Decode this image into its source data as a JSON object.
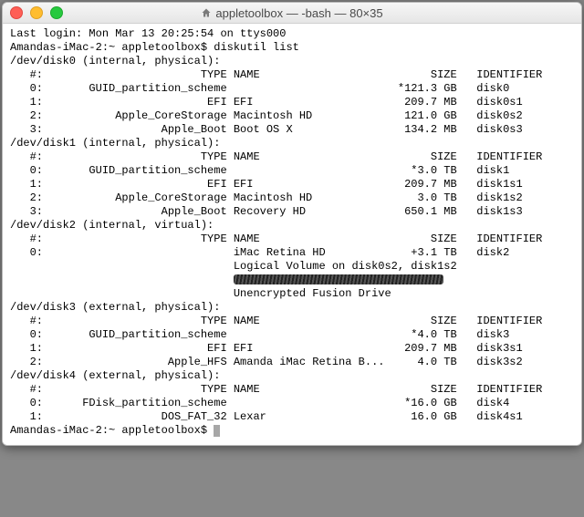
{
  "window": {
    "title": "appletoolbox — -bash — 80×35"
  },
  "login_line": "Last login: Mon Mar 13 20:25:54 on ttys000",
  "prompt1": "Amandas-iMac-2:~ appletoolbox$ ",
  "command1": "diskutil list",
  "prompt2": "Amandas-iMac-2:~ appletoolbox$ ",
  "header_cols": {
    "num": "#:",
    "type": "TYPE",
    "name": "NAME",
    "size": "SIZE",
    "id": "IDENTIFIER"
  },
  "disks": [
    {
      "header": "/dev/disk0 (internal, physical):",
      "rows": [
        {
          "num": "0:",
          "type": "GUID_partition_scheme",
          "name": "",
          "size": "*121.3 GB",
          "id": "disk0"
        },
        {
          "num": "1:",
          "type": "EFI",
          "name": "EFI",
          "size": "209.7 MB",
          "id": "disk0s1"
        },
        {
          "num": "2:",
          "type": "Apple_CoreStorage",
          "name": "Macintosh HD",
          "size": "121.0 GB",
          "id": "disk0s2"
        },
        {
          "num": "3:",
          "type": "Apple_Boot",
          "name": "Boot OS X",
          "size": "134.2 MB",
          "id": "disk0s3"
        }
      ]
    },
    {
      "header": "/dev/disk1 (internal, physical):",
      "rows": [
        {
          "num": "0:",
          "type": "GUID_partition_scheme",
          "name": "",
          "size": "*3.0 TB",
          "id": "disk1"
        },
        {
          "num": "1:",
          "type": "EFI",
          "name": "EFI",
          "size": "209.7 MB",
          "id": "disk1s1"
        },
        {
          "num": "2:",
          "type": "Apple_CoreStorage",
          "name": "Macintosh HD",
          "size": "3.0 TB",
          "id": "disk1s2"
        },
        {
          "num": "3:",
          "type": "Apple_Boot",
          "name": "Recovery HD",
          "size": "650.1 MB",
          "id": "disk1s3"
        }
      ]
    },
    {
      "header": "/dev/disk2 (internal, virtual):",
      "rows": [
        {
          "num": "0:",
          "type": "",
          "name": "iMac Retina HD",
          "size": "+3.1 TB",
          "id": "disk2"
        }
      ],
      "extra": [
        "Logical Volume on disk0s2, disk1s2",
        "__REDACTED__",
        "Unencrypted Fusion Drive"
      ]
    },
    {
      "header": "/dev/disk3 (external, physical):",
      "rows": [
        {
          "num": "0:",
          "type": "GUID_partition_scheme",
          "name": "",
          "size": "*4.0 TB",
          "id": "disk3"
        },
        {
          "num": "1:",
          "type": "EFI",
          "name": "EFI",
          "size": "209.7 MB",
          "id": "disk3s1"
        },
        {
          "num": "2:",
          "type": "Apple_HFS",
          "name": "Amanda iMac Retina B...",
          "size": "4.0 TB",
          "id": "disk3s2"
        }
      ]
    },
    {
      "header": "/dev/disk4 (external, physical):",
      "rows": [
        {
          "num": "0:",
          "type": "FDisk_partition_scheme",
          "name": "",
          "size": "*16.0 GB",
          "id": "disk4"
        },
        {
          "num": "1:",
          "type": "DOS_FAT_32",
          "name": "Lexar",
          "size": "16.0 GB",
          "id": "disk4s1"
        }
      ]
    }
  ]
}
